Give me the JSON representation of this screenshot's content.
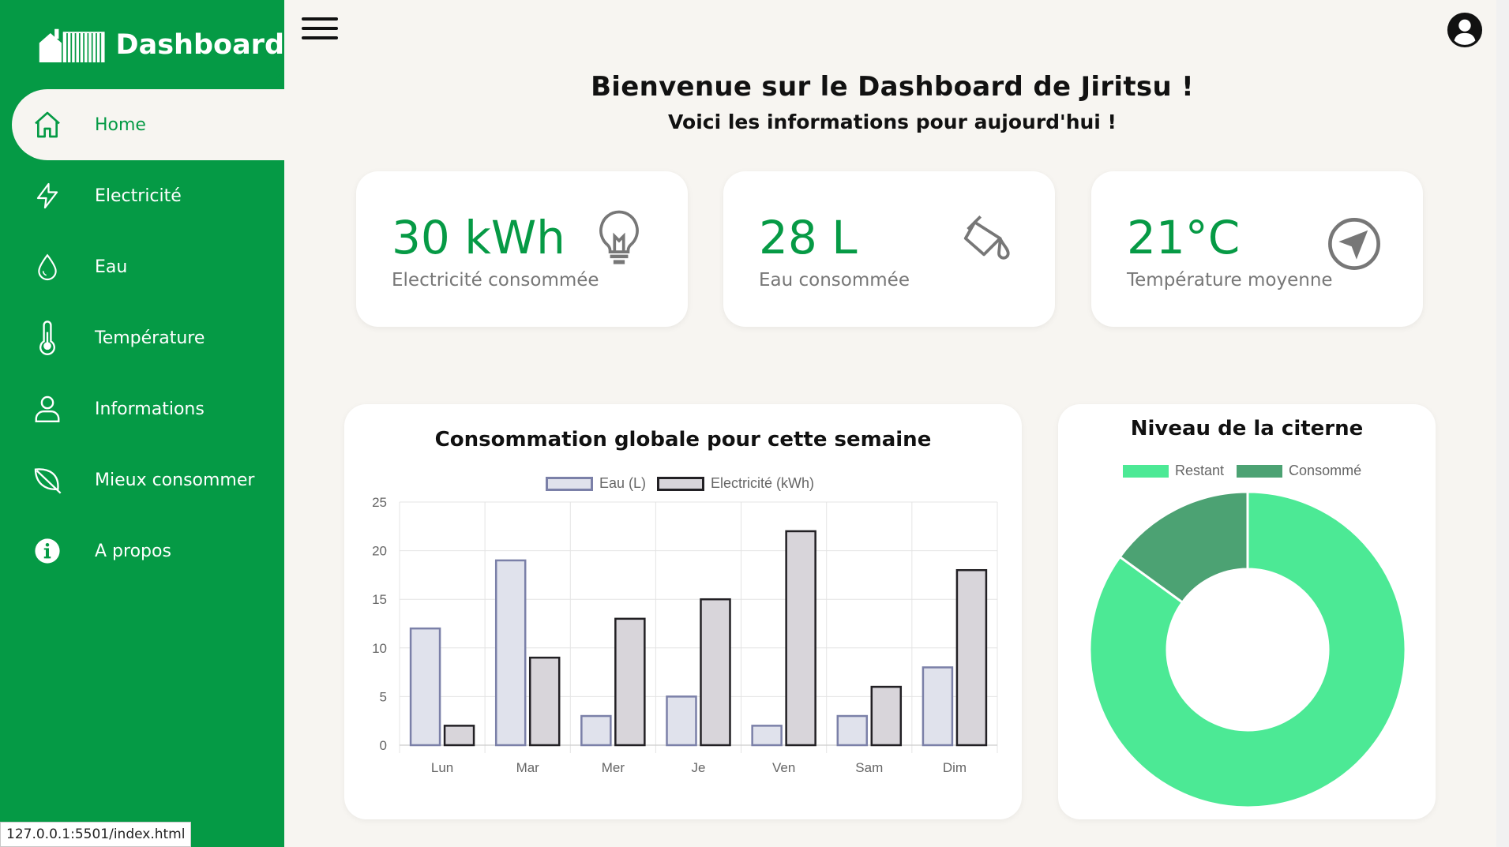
{
  "brand": {
    "title": "Dashboard"
  },
  "nav": [
    {
      "label": "Home",
      "icon": "home-icon"
    },
    {
      "label": "Electricité",
      "icon": "lightning-icon"
    },
    {
      "label": "Eau",
      "icon": "water-drop-icon"
    },
    {
      "label": "Température",
      "icon": "thermometer-icon"
    },
    {
      "label": "Informations",
      "icon": "user-icon"
    },
    {
      "label": "Mieux consommer",
      "icon": "leaf-icon"
    },
    {
      "label": "A propos",
      "icon": "info-icon"
    }
  ],
  "status_url": "127.0.0.1:5501/index.html",
  "welcome": {
    "title": "Bienvenue sur le Dashboard de Jiritsu !",
    "subtitle": "Voici les informations pour aujourd'hui !"
  },
  "cards": [
    {
      "value": "30 kWh",
      "label": "Electricité consommée",
      "icon": "lightbulb-icon"
    },
    {
      "value": "28 L",
      "label": "Eau consommée",
      "icon": "paint-bucket-icon"
    },
    {
      "value": "21°C",
      "label": "Température moyenne",
      "icon": "navigation-arrow-icon"
    }
  ],
  "colors": {
    "sidebar": "#059a45",
    "accent": "#069a45",
    "eau_fill": "#e0e2ec",
    "eau_border": "#7b80a8",
    "elec_fill": "#d8d5da",
    "elec_border": "#222024",
    "restant": "#4ce995",
    "consomme": "#4ca273"
  },
  "chart_data": [
    {
      "type": "bar",
      "title": "Consommation globale pour cette semaine",
      "categories": [
        "Lun",
        "Mar",
        "Mer",
        "Je",
        "Ven",
        "Sam",
        "Dim"
      ],
      "series": [
        {
          "name": "Eau (L)",
          "values": [
            12,
            19,
            3,
            5,
            2,
            3,
            8
          ]
        },
        {
          "name": "Electricité (kWh)",
          "values": [
            2,
            9,
            13,
            15,
            22,
            6,
            18
          ]
        }
      ],
      "ylim": [
        0,
        25
      ],
      "yticks": [
        0,
        5,
        10,
        15,
        20,
        25
      ],
      "grid": true,
      "legend": "top"
    },
    {
      "type": "pie",
      "title": "Niveau de la citerne",
      "labels": [
        "Restant",
        "Consommé"
      ],
      "values": [
        85,
        15
      ],
      "doughnut": true,
      "legend": "top"
    }
  ]
}
